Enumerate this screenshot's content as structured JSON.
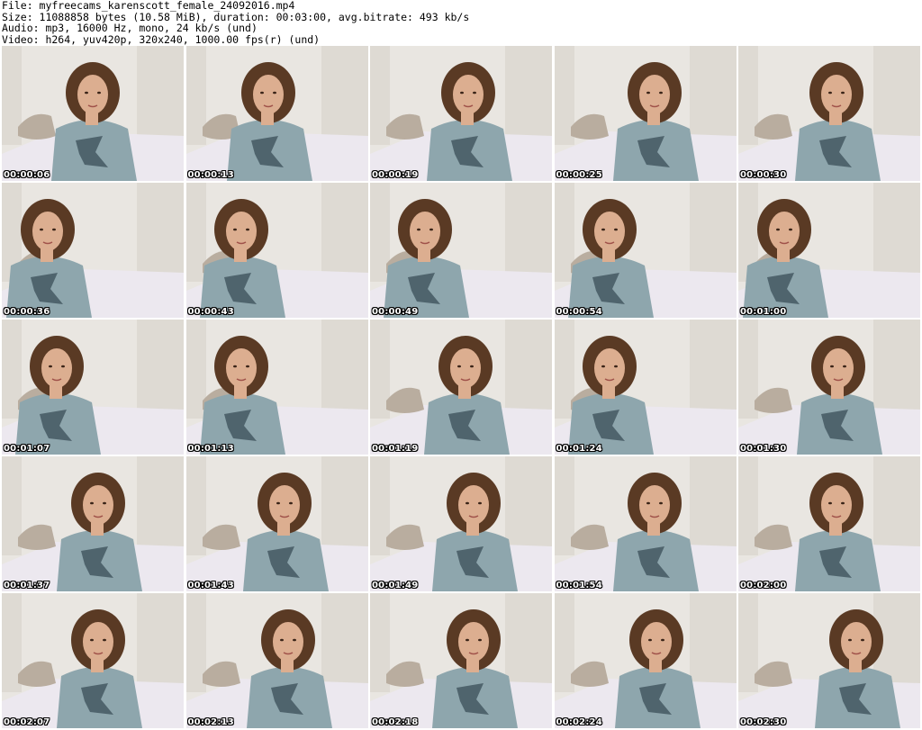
{
  "header": {
    "file_line": "File: myfreecams_karenscott_female_24092016.mp4",
    "size_line": "Size: 11088858 bytes (10.58 MiB), duration: 00:03:00, avg.bitrate: 493 kb/s",
    "audio_line": "Audio: mp3, 16000 Hz, mono, 24 kb/s (und)",
    "video_line": "Video: h264, yuv420p, 320x240, 1000.00 fps(r) (und)"
  },
  "thumbnails": [
    {
      "timestamp": "00:00:06"
    },
    {
      "timestamp": "00:00:13"
    },
    {
      "timestamp": "00:00:19"
    },
    {
      "timestamp": "00:00:25"
    },
    {
      "timestamp": "00:00:30"
    },
    {
      "timestamp": "00:00:36"
    },
    {
      "timestamp": "00:00:43"
    },
    {
      "timestamp": "00:00:49"
    },
    {
      "timestamp": "00:00:54"
    },
    {
      "timestamp": "00:01:00"
    },
    {
      "timestamp": "00:01:07"
    },
    {
      "timestamp": "00:01:13"
    },
    {
      "timestamp": "00:01:19"
    },
    {
      "timestamp": "00:01:24"
    },
    {
      "timestamp": "00:01:30"
    },
    {
      "timestamp": "00:01:37"
    },
    {
      "timestamp": "00:01:43"
    },
    {
      "timestamp": "00:01:49"
    },
    {
      "timestamp": "00:01:54"
    },
    {
      "timestamp": "00:02:00"
    },
    {
      "timestamp": "00:02:07"
    },
    {
      "timestamp": "00:02:13"
    },
    {
      "timestamp": "00:02:18"
    },
    {
      "timestamp": "00:02:24"
    },
    {
      "timestamp": "00:02:30"
    }
  ],
  "colors": {
    "wall": "#e9e6e1",
    "wall_panel": "#dedad3",
    "bed": "#ece8ef",
    "pillow": "#b9ad9f",
    "shirt": "#8ea6ad",
    "shirt_print": "#4f646d",
    "hair": "#5a3a24",
    "skin": "#dcae90"
  }
}
